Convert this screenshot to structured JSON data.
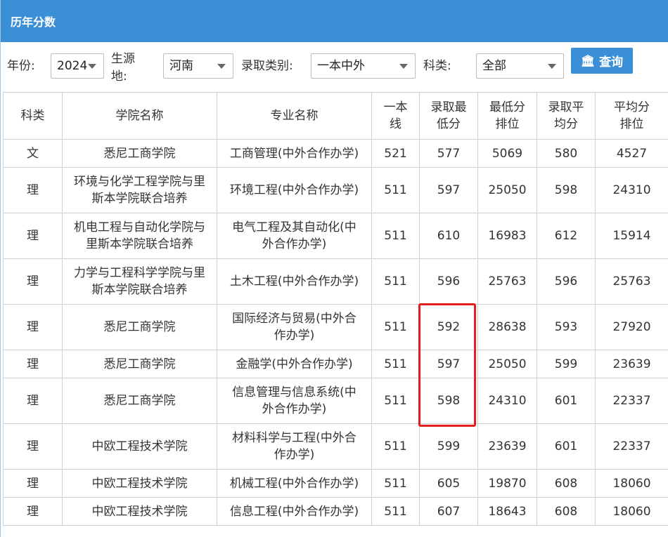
{
  "header": {
    "title": "历年分数"
  },
  "filters": {
    "year": {
      "label": "年份:",
      "value": "2024"
    },
    "origin": {
      "label_line1": "生源",
      "label_line2": "地:",
      "value": "河南"
    },
    "category": {
      "label": "录取类别:",
      "value": "一本中外"
    },
    "subject": {
      "label": "科类:",
      "value": "全部"
    },
    "query_button": {
      "label": "查询",
      "icon": "building-icon"
    }
  },
  "table": {
    "headers": [
      [
        "科类"
      ],
      [
        "学院名称"
      ],
      [
        "专业名称"
      ],
      [
        "一本",
        "线"
      ],
      [
        "录取最",
        "低分"
      ],
      [
        "最低分",
        "排位"
      ],
      [
        "录取平",
        "均分"
      ],
      [
        "平均分",
        "排位"
      ]
    ],
    "rows": [
      {
        "subject": "文",
        "college": [
          "悉尼工商学院"
        ],
        "major": [
          "工商管理(中外合作办学)"
        ],
        "line": "521",
        "min": "577",
        "min_rank": "5069",
        "avg": "580",
        "avg_rank": "4527"
      },
      {
        "subject": "理",
        "college": [
          "环境与化学工程学院与里",
          "斯本学院联合培养"
        ],
        "major": [
          "环境工程(中外合作办学)"
        ],
        "line": "511",
        "min": "597",
        "min_rank": "25050",
        "avg": "598",
        "avg_rank": "24310"
      },
      {
        "subject": "理",
        "college": [
          "机电工程与自动化学院与",
          "里斯本学院联合培养"
        ],
        "major": [
          "电气工程及其自动化(中",
          "外合作办学)"
        ],
        "line": "511",
        "min": "610",
        "min_rank": "16983",
        "avg": "612",
        "avg_rank": "15914"
      },
      {
        "subject": "理",
        "college": [
          "力学与工程科学学院与里",
          "斯本学院联合培养"
        ],
        "major": [
          "土木工程(中外合作办学)"
        ],
        "line": "511",
        "min": "596",
        "min_rank": "25763",
        "avg": "596",
        "avg_rank": "25763"
      },
      {
        "subject": "理",
        "college": [
          "悉尼工商学院"
        ],
        "major": [
          "国际经济与贸易(中外合",
          "作办学)"
        ],
        "line": "511",
        "min": "592",
        "min_rank": "28638",
        "avg": "593",
        "avg_rank": "27920"
      },
      {
        "subject": "理",
        "college": [
          "悉尼工商学院"
        ],
        "major": [
          "金融学(中外合作办学)"
        ],
        "line": "511",
        "min": "597",
        "min_rank": "25050",
        "avg": "599",
        "avg_rank": "23639"
      },
      {
        "subject": "理",
        "college": [
          "悉尼工商学院"
        ],
        "major": [
          "信息管理与信息系统(中",
          "外合作办学)"
        ],
        "line": "511",
        "min": "598",
        "min_rank": "24310",
        "avg": "601",
        "avg_rank": "22337"
      },
      {
        "subject": "理",
        "college": [
          "中欧工程技术学院"
        ],
        "major": [
          "材料科学与工程(中外合",
          "作办学)"
        ],
        "line": "511",
        "min": "599",
        "min_rank": "23639",
        "avg": "601",
        "avg_rank": "22337"
      },
      {
        "subject": "理",
        "college": [
          "中欧工程技术学院"
        ],
        "major": [
          "机械工程(中外合作办学)"
        ],
        "line": "511",
        "min": "605",
        "min_rank": "19870",
        "avg": "608",
        "avg_rank": "18060"
      },
      {
        "subject": "理",
        "college": [
          "中欧工程技术学院"
        ],
        "major": [
          "信息工程(中外合作办学)"
        ],
        "line": "511",
        "min": "607",
        "min_rank": "18643",
        "avg": "608",
        "avg_rank": "18060"
      }
    ]
  },
  "colors": {
    "header_bg": "#3b8fd6",
    "highlight_border": "#e21f1f"
  }
}
